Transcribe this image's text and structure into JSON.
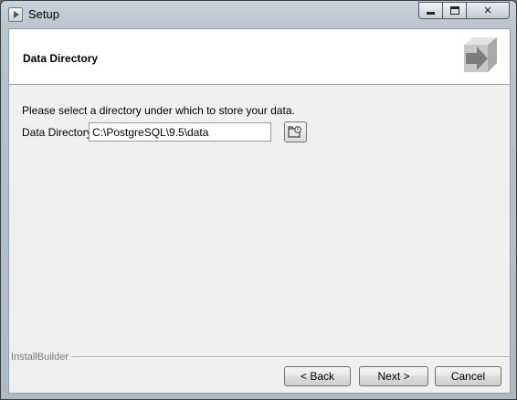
{
  "window": {
    "title": "Setup"
  },
  "header": {
    "title": "Data Directory",
    "logo_icon": "package-arrow-icon"
  },
  "main": {
    "prompt": "Please select a directory under which to store your data.",
    "field_label": "Data Directory",
    "field_value": "C:\\PostgreSQL\\9.5\\data",
    "browse_icon": "folder-browse-icon"
  },
  "footer": {
    "brand": "InstallBuilder",
    "back_label": "< Back",
    "next_label": "Next >",
    "cancel_label": "Cancel"
  },
  "titlebar_controls": {
    "close_glyph": "✕"
  }
}
